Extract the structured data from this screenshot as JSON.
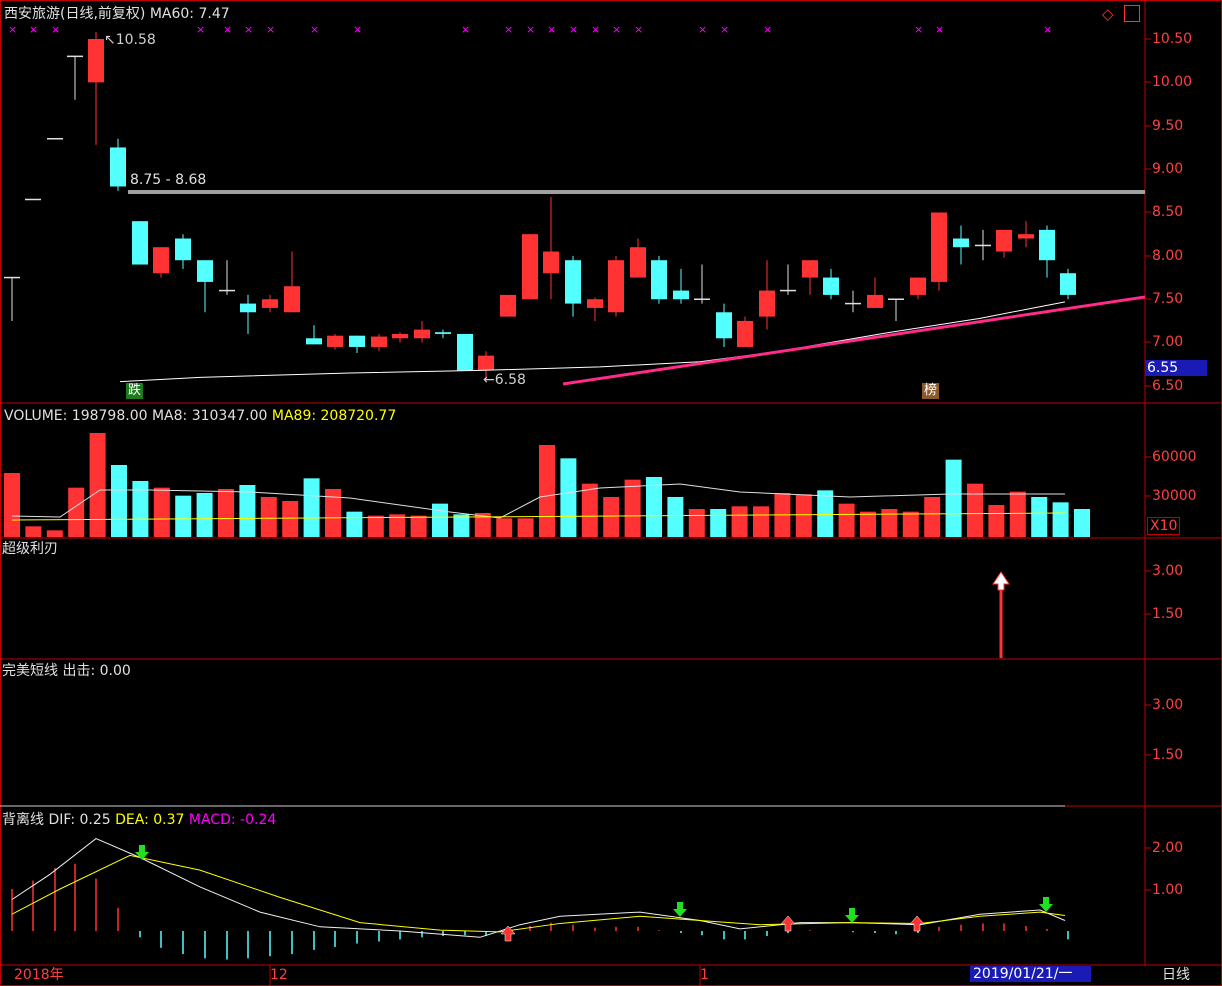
{
  "header": {
    "title": "西安旅游(日线,前复权)",
    "ma60_label": "MA60:",
    "ma60_value": "7.47"
  },
  "price_panel": {
    "axis_ticks": [
      "10.50",
      "10.00",
      "9.50",
      "9.00",
      "8.50",
      "8.00",
      "7.50",
      "7.00",
      "6.50"
    ],
    "current_price_tag": "6.55",
    "high_annotation": "10.58",
    "low_annotation": "6.58",
    "resistance_label": "8.75 - 8.68",
    "badge_die": "跌",
    "badge_bang": "榜"
  },
  "volume_panel": {
    "vol_label": "VOLUME:",
    "vol_value": "198798.00",
    "ma8_label": "MA8:",
    "ma8_value": "310347.00",
    "ma89_label": "MA89:",
    "ma89_value": "208720.77",
    "axis_ticks": [
      "60000",
      "30000"
    ],
    "unit": "X10"
  },
  "indicator1": {
    "title": "超级利刃",
    "axis_ticks": [
      "3.00",
      "1.50"
    ]
  },
  "indicator2": {
    "title": "完美短线",
    "out_label": "出击:",
    "out_value": "0.00",
    "axis_ticks": [
      "3.00",
      "1.50"
    ]
  },
  "macd_panel": {
    "title": "背离线",
    "dif_label": "DIF:",
    "dif_value": "0.25",
    "dea_label": "DEA:",
    "dea_value": "0.37",
    "macd_label": "MACD:",
    "macd_value": "-0.24",
    "axis_ticks": [
      "2.00",
      "1.00"
    ]
  },
  "time_axis": {
    "labels": [
      "2018年",
      "12",
      "1"
    ],
    "cursor_date": "2019/01/21/一",
    "period": "日线"
  },
  "colors": {
    "up": "#ff3333",
    "down": "#54ffff",
    "axis": "#c00000",
    "ma60": "#ffffff",
    "trendline": "#ff2a8a",
    "resistance": "#a0a0a0",
    "ma89": "#ffff00",
    "macd_label": "#ff00ff",
    "marker": "#ff00ff"
  }
}
